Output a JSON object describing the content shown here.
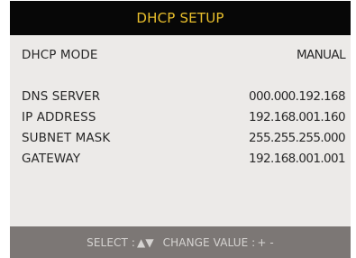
{
  "header": {
    "title": "DHCP SETUP"
  },
  "settings": {
    "dhcp_mode": {
      "label": "DHCP MODE",
      "value": "MANUAL"
    },
    "dns_server": {
      "label": "DNS SERVER",
      "value": "000.000.192.168"
    },
    "ip_address": {
      "label": "IP ADDRESS",
      "value": "192.168.001.160"
    },
    "subnet_mask": {
      "label": "SUBNET MASK",
      "value": "255.255.255.000"
    },
    "gateway": {
      "label": "GATEWAY",
      "value": "192.168.001.001"
    }
  },
  "footer": {
    "select_label": "SELECT :",
    "select_keys": "▲▼",
    "change_label": "CHANGE VALUE :",
    "change_keys": "+ -"
  },
  "colors": {
    "title_bg": "#070707",
    "title_text": "#e9bf2c",
    "panel_bg": "#eceae8",
    "footer_bg": "#7c7775"
  }
}
